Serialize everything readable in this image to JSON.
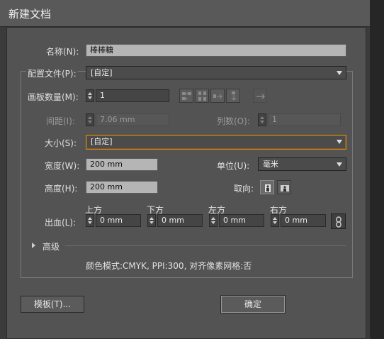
{
  "window": {
    "title": "新建文档"
  },
  "name": {
    "label": "名称(N):",
    "value": "棒棒糖"
  },
  "profile": {
    "label": "配置文件(P):",
    "value": "[自定]"
  },
  "artboards": {
    "label": "画板数量(M):",
    "value": "1"
  },
  "spacing": {
    "label": "间距(I):",
    "value": "7.06 mm"
  },
  "columns": {
    "label": "列数(O):",
    "value": "1"
  },
  "size": {
    "label": "大小(S):",
    "value": "[自定]"
  },
  "width": {
    "label": "宽度(W):",
    "value": "200 mm"
  },
  "units": {
    "label": "单位(U):",
    "value": "毫米"
  },
  "height": {
    "label": "高度(H):",
    "value": "200 mm"
  },
  "orientation": {
    "label": "取向:"
  },
  "bleed": {
    "label": "出血(L):",
    "top": {
      "label": "上方",
      "value": "0 mm"
    },
    "bottom": {
      "label": "下方",
      "value": "0 mm"
    },
    "left": {
      "label": "左方",
      "value": "0 mm"
    },
    "right": {
      "label": "右方",
      "value": "0 mm"
    }
  },
  "advanced": {
    "label": "高级"
  },
  "info": {
    "text": "颜色模式:CMYK, PPI:300, 对齐像素网格:否"
  },
  "buttons": {
    "templates": "模板(T)...",
    "ok": "确定"
  }
}
